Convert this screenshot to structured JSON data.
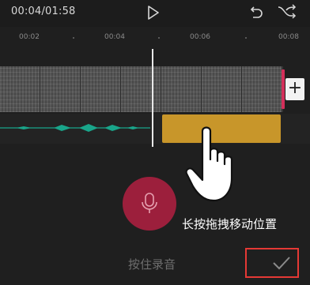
{
  "header": {
    "time": "00:04/01:58",
    "play_icon": "play-icon",
    "undo_icon": "undo-icon",
    "redo_icon": "redo-icon"
  },
  "timeline": {
    "ticks": [
      "00:02",
      "00:04",
      "00:06",
      "00:08"
    ]
  },
  "strip": {
    "add_label": "+",
    "add_icon": "plus-icon"
  },
  "recorder": {
    "mic_icon": "microphone-icon",
    "drag_hint": "长按拖拽移动位置",
    "hold_label": "按住录音",
    "confirm_icon": "checkmark-icon",
    "hand_icon": "pointing-hand-icon"
  },
  "colors": {
    "accent_record": "#9c1f3c",
    "audio_clip": "#c8962a",
    "waveform": "#19a58a",
    "highlight_box": "#e53935"
  }
}
